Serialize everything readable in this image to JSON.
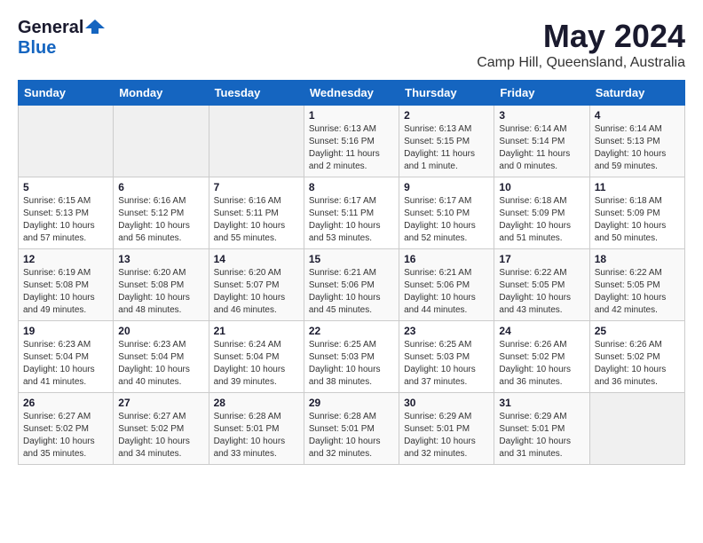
{
  "logo": {
    "general": "General",
    "blue": "Blue"
  },
  "title": "May 2024",
  "subtitle": "Camp Hill, Queensland, Australia",
  "weekdays": [
    "Sunday",
    "Monday",
    "Tuesday",
    "Wednesday",
    "Thursday",
    "Friday",
    "Saturday"
  ],
  "weeks": [
    [
      {
        "day": "",
        "sunrise": "",
        "sunset": "",
        "daylight": ""
      },
      {
        "day": "",
        "sunrise": "",
        "sunset": "",
        "daylight": ""
      },
      {
        "day": "",
        "sunrise": "",
        "sunset": "",
        "daylight": ""
      },
      {
        "day": "1",
        "sunrise": "Sunrise: 6:13 AM",
        "sunset": "Sunset: 5:16 PM",
        "daylight": "Daylight: 11 hours and 2 minutes."
      },
      {
        "day": "2",
        "sunrise": "Sunrise: 6:13 AM",
        "sunset": "Sunset: 5:15 PM",
        "daylight": "Daylight: 11 hours and 1 minute."
      },
      {
        "day": "3",
        "sunrise": "Sunrise: 6:14 AM",
        "sunset": "Sunset: 5:14 PM",
        "daylight": "Daylight: 11 hours and 0 minutes."
      },
      {
        "day": "4",
        "sunrise": "Sunrise: 6:14 AM",
        "sunset": "Sunset: 5:13 PM",
        "daylight": "Daylight: 10 hours and 59 minutes."
      }
    ],
    [
      {
        "day": "5",
        "sunrise": "Sunrise: 6:15 AM",
        "sunset": "Sunset: 5:13 PM",
        "daylight": "Daylight: 10 hours and 57 minutes."
      },
      {
        "day": "6",
        "sunrise": "Sunrise: 6:16 AM",
        "sunset": "Sunset: 5:12 PM",
        "daylight": "Daylight: 10 hours and 56 minutes."
      },
      {
        "day": "7",
        "sunrise": "Sunrise: 6:16 AM",
        "sunset": "Sunset: 5:11 PM",
        "daylight": "Daylight: 10 hours and 55 minutes."
      },
      {
        "day": "8",
        "sunrise": "Sunrise: 6:17 AM",
        "sunset": "Sunset: 5:11 PM",
        "daylight": "Daylight: 10 hours and 53 minutes."
      },
      {
        "day": "9",
        "sunrise": "Sunrise: 6:17 AM",
        "sunset": "Sunset: 5:10 PM",
        "daylight": "Daylight: 10 hours and 52 minutes."
      },
      {
        "day": "10",
        "sunrise": "Sunrise: 6:18 AM",
        "sunset": "Sunset: 5:09 PM",
        "daylight": "Daylight: 10 hours and 51 minutes."
      },
      {
        "day": "11",
        "sunrise": "Sunrise: 6:18 AM",
        "sunset": "Sunset: 5:09 PM",
        "daylight": "Daylight: 10 hours and 50 minutes."
      }
    ],
    [
      {
        "day": "12",
        "sunrise": "Sunrise: 6:19 AM",
        "sunset": "Sunset: 5:08 PM",
        "daylight": "Daylight: 10 hours and 49 minutes."
      },
      {
        "day": "13",
        "sunrise": "Sunrise: 6:20 AM",
        "sunset": "Sunset: 5:08 PM",
        "daylight": "Daylight: 10 hours and 48 minutes."
      },
      {
        "day": "14",
        "sunrise": "Sunrise: 6:20 AM",
        "sunset": "Sunset: 5:07 PM",
        "daylight": "Daylight: 10 hours and 46 minutes."
      },
      {
        "day": "15",
        "sunrise": "Sunrise: 6:21 AM",
        "sunset": "Sunset: 5:06 PM",
        "daylight": "Daylight: 10 hours and 45 minutes."
      },
      {
        "day": "16",
        "sunrise": "Sunrise: 6:21 AM",
        "sunset": "Sunset: 5:06 PM",
        "daylight": "Daylight: 10 hours and 44 minutes."
      },
      {
        "day": "17",
        "sunrise": "Sunrise: 6:22 AM",
        "sunset": "Sunset: 5:05 PM",
        "daylight": "Daylight: 10 hours and 43 minutes."
      },
      {
        "day": "18",
        "sunrise": "Sunrise: 6:22 AM",
        "sunset": "Sunset: 5:05 PM",
        "daylight": "Daylight: 10 hours and 42 minutes."
      }
    ],
    [
      {
        "day": "19",
        "sunrise": "Sunrise: 6:23 AM",
        "sunset": "Sunset: 5:04 PM",
        "daylight": "Daylight: 10 hours and 41 minutes."
      },
      {
        "day": "20",
        "sunrise": "Sunrise: 6:23 AM",
        "sunset": "Sunset: 5:04 PM",
        "daylight": "Daylight: 10 hours and 40 minutes."
      },
      {
        "day": "21",
        "sunrise": "Sunrise: 6:24 AM",
        "sunset": "Sunset: 5:04 PM",
        "daylight": "Daylight: 10 hours and 39 minutes."
      },
      {
        "day": "22",
        "sunrise": "Sunrise: 6:25 AM",
        "sunset": "Sunset: 5:03 PM",
        "daylight": "Daylight: 10 hours and 38 minutes."
      },
      {
        "day": "23",
        "sunrise": "Sunrise: 6:25 AM",
        "sunset": "Sunset: 5:03 PM",
        "daylight": "Daylight: 10 hours and 37 minutes."
      },
      {
        "day": "24",
        "sunrise": "Sunrise: 6:26 AM",
        "sunset": "Sunset: 5:02 PM",
        "daylight": "Daylight: 10 hours and 36 minutes."
      },
      {
        "day": "25",
        "sunrise": "Sunrise: 6:26 AM",
        "sunset": "Sunset: 5:02 PM",
        "daylight": "Daylight: 10 hours and 36 minutes."
      }
    ],
    [
      {
        "day": "26",
        "sunrise": "Sunrise: 6:27 AM",
        "sunset": "Sunset: 5:02 PM",
        "daylight": "Daylight: 10 hours and 35 minutes."
      },
      {
        "day": "27",
        "sunrise": "Sunrise: 6:27 AM",
        "sunset": "Sunset: 5:02 PM",
        "daylight": "Daylight: 10 hours and 34 minutes."
      },
      {
        "day": "28",
        "sunrise": "Sunrise: 6:28 AM",
        "sunset": "Sunset: 5:01 PM",
        "daylight": "Daylight: 10 hours and 33 minutes."
      },
      {
        "day": "29",
        "sunrise": "Sunrise: 6:28 AM",
        "sunset": "Sunset: 5:01 PM",
        "daylight": "Daylight: 10 hours and 32 minutes."
      },
      {
        "day": "30",
        "sunrise": "Sunrise: 6:29 AM",
        "sunset": "Sunset: 5:01 PM",
        "daylight": "Daylight: 10 hours and 32 minutes."
      },
      {
        "day": "31",
        "sunrise": "Sunrise: 6:29 AM",
        "sunset": "Sunset: 5:01 PM",
        "daylight": "Daylight: 10 hours and 31 minutes."
      },
      {
        "day": "",
        "sunrise": "",
        "sunset": "",
        "daylight": ""
      }
    ]
  ]
}
